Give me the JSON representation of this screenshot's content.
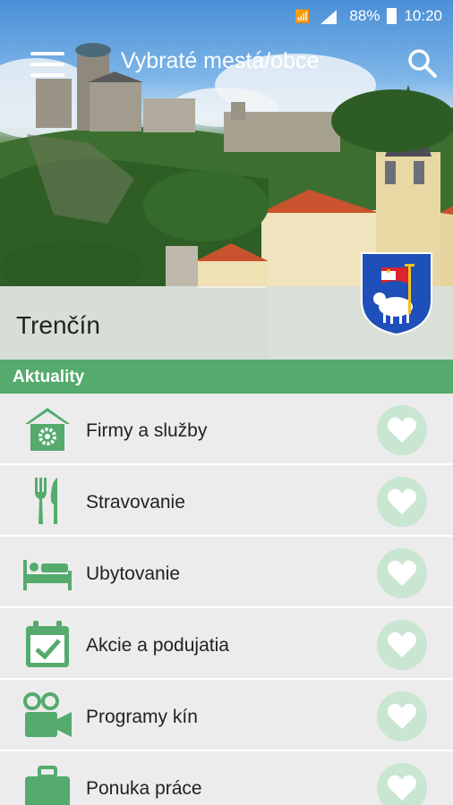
{
  "status_bar": {
    "battery": "88%",
    "time": "10:20"
  },
  "toolbar": {
    "title": "Vybraté mestá/obce",
    "menu_icon": "hamburger-menu-icon",
    "search_icon": "search-icon"
  },
  "city": {
    "name": "Trenčín",
    "crest_icon": "city-crest-icon"
  },
  "section": {
    "title": "Aktuality"
  },
  "colors": {
    "accent": "#55aa6e",
    "icon_green": "#55aa6e",
    "fav_circle": "#c9e6d2"
  },
  "categories": [
    {
      "label": "Firmy a služby",
      "icon": "house-gear-icon"
    },
    {
      "label": "Stravovanie",
      "icon": "fork-knife-icon"
    },
    {
      "label": "Ubytovanie",
      "icon": "bed-icon"
    },
    {
      "label": "Akcie a podujatia",
      "icon": "calendar-check-icon"
    },
    {
      "label": "Programy kín",
      "icon": "video-camera-icon"
    },
    {
      "label": "Ponuka práce",
      "icon": "briefcase-icon"
    }
  ]
}
